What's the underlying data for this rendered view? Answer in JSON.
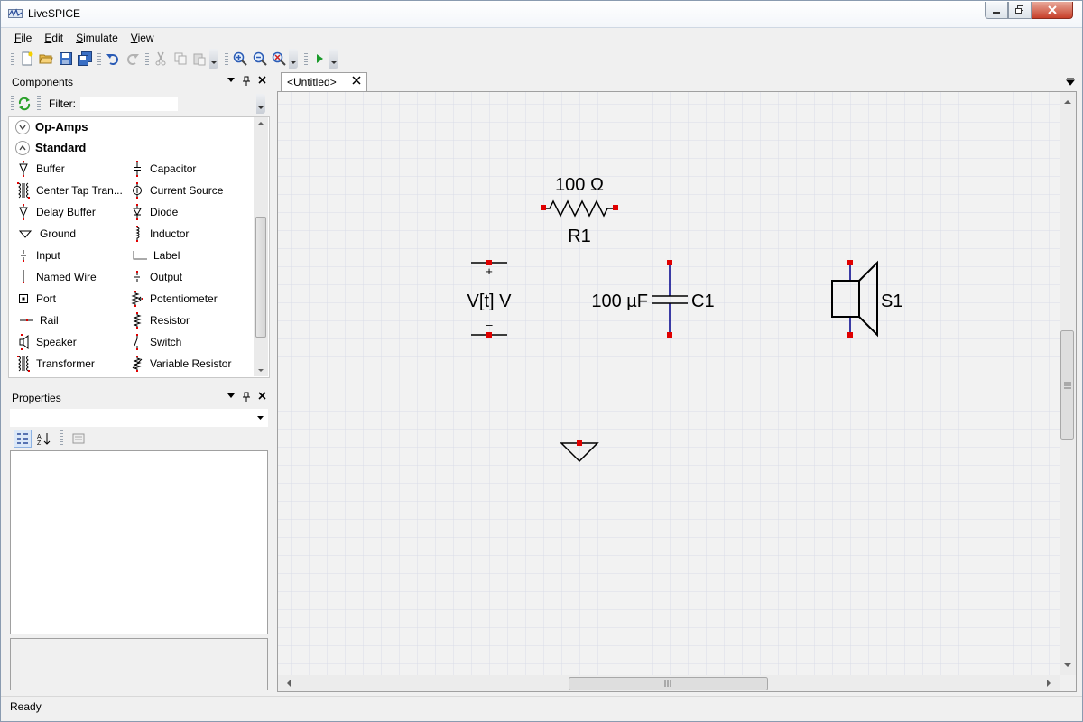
{
  "app": {
    "title": "LiveSPICE"
  },
  "menu": [
    {
      "label": "File",
      "key": "F",
      "rest": "ile"
    },
    {
      "label": "Edit",
      "key": "E",
      "rest": "dit"
    },
    {
      "label": "Simulate",
      "key": "S",
      "rest": "imulate"
    },
    {
      "label": "View",
      "key": "V",
      "rest": "iew"
    }
  ],
  "components_panel": {
    "title": "Components",
    "filter_label": "Filter:",
    "filter_value": "",
    "groups": [
      {
        "label": "Op-Amps",
        "expanded": false
      },
      {
        "label": "Standard",
        "expanded": true
      }
    ],
    "items": [
      {
        "label": "Buffer",
        "icon": "buffer-icon"
      },
      {
        "label": "Capacitor",
        "icon": "capacitor-icon"
      },
      {
        "label": "Center Tap Tran...",
        "icon": "transformer-icon"
      },
      {
        "label": "Current Source",
        "icon": "current-source-icon"
      },
      {
        "label": "Delay Buffer",
        "icon": "buffer-icon"
      },
      {
        "label": "Diode",
        "icon": "diode-icon"
      },
      {
        "label": "Ground",
        "icon": "ground-icon"
      },
      {
        "label": "Inductor",
        "icon": "inductor-icon"
      },
      {
        "label": "Input",
        "icon": "input-icon"
      },
      {
        "label": "Label",
        "icon": "label-icon"
      },
      {
        "label": "Named Wire",
        "icon": "named-wire-icon"
      },
      {
        "label": "Output",
        "icon": "output-icon"
      },
      {
        "label": "Port",
        "icon": "port-icon"
      },
      {
        "label": "Potentiometer",
        "icon": "potentiometer-icon"
      },
      {
        "label": "Rail",
        "icon": "rail-icon"
      },
      {
        "label": "Resistor",
        "icon": "resistor-icon"
      },
      {
        "label": "Speaker",
        "icon": "speaker-icon"
      },
      {
        "label": "Switch",
        "icon": "switch-icon"
      },
      {
        "label": "Transformer",
        "icon": "transformer-icon"
      },
      {
        "label": "Variable Resistor",
        "icon": "variable-resistor-icon"
      }
    ]
  },
  "properties_panel": {
    "title": "Properties"
  },
  "document": {
    "tab_label": "<Untitled>",
    "schematic": {
      "resistor": {
        "value": "100 Ω",
        "name": "R1"
      },
      "source": {
        "value": "V[t] V",
        "plus": "+",
        "minus": "–"
      },
      "capacitor": {
        "value": "100 µF",
        "name": "C1"
      },
      "speaker": {
        "name": "S1"
      }
    }
  },
  "status": {
    "text": "Ready"
  },
  "colors": {
    "wire": "#00008b",
    "terminal": "#e00000",
    "grid": "#d9dce8"
  }
}
